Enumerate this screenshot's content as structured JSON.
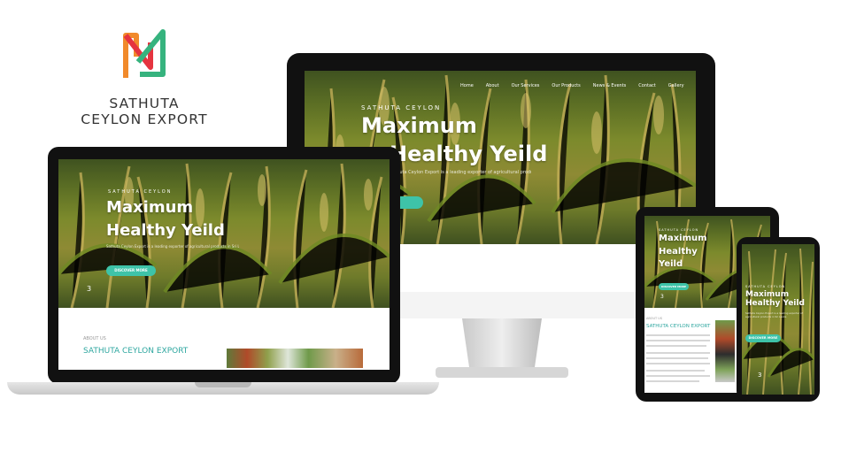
{
  "brand": {
    "line1": "SATHUTA",
    "line2": "CEYLON EXPORT",
    "colors": {
      "orange": "#f18a2b",
      "red": "#e5343f",
      "green": "#36b37e"
    }
  },
  "hero": {
    "kicker": "SATHUTA CEYLON",
    "title_line1": "Maximum",
    "title_line2": "Healthy Yeild",
    "subtitle": "Sathuta Ceylon Export is a leading exporter of agricultural products in Sri Lanka",
    "cta": "DISCOVER MORE",
    "cta_color": "#3ec3a8",
    "slide_current": "3"
  },
  "nav": [
    "Home",
    "About",
    "Our Services",
    "Our Products",
    "News & Events",
    "Contact",
    "Gallery"
  ],
  "about": {
    "label": "ABOUT US",
    "heading": "SATHUTA CEYLON EXPORT"
  }
}
